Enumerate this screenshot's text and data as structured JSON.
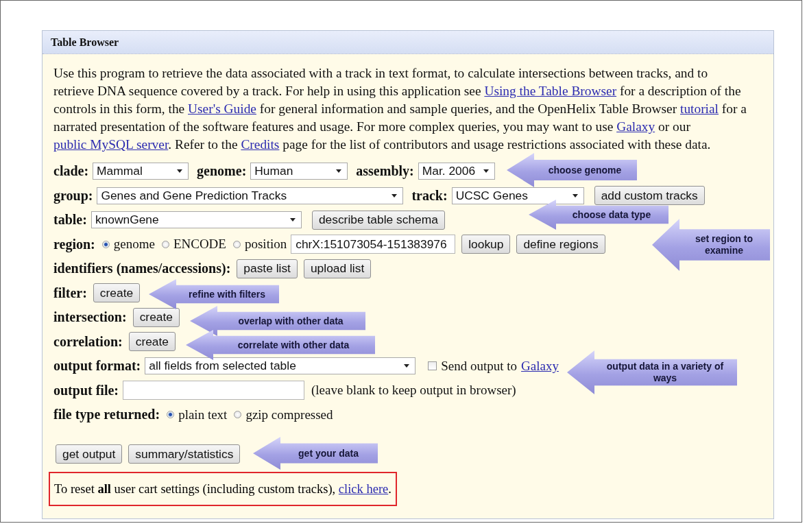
{
  "panel": {
    "title": "Table Browser"
  },
  "intro": [
    {
      "kind": "text",
      "text": "Use this program to retrieve the data associated with a track in text format, to calculate intersections between tracks, and to retrieve DNA sequence covered by a track. For help in using this application see "
    },
    {
      "kind": "link",
      "text": "Using the Table Browser"
    },
    {
      "kind": "text",
      "text": " for a description of the controls in this form, the "
    },
    {
      "kind": "link",
      "text": "User's Guide"
    },
    {
      "kind": "text",
      "text": " for general information and sample queries, and the OpenHelix Table Browser "
    },
    {
      "kind": "link",
      "text": "tutorial"
    },
    {
      "kind": "text",
      "text": " for a narrated presentation of the software features and usage. For more complex queries, you may want to use "
    },
    {
      "kind": "link",
      "text": "Galaxy"
    },
    {
      "kind": "text",
      "text": " or our "
    },
    {
      "kind": "link",
      "text": "public MySQL server"
    },
    {
      "kind": "text",
      "text": ". Refer to the "
    },
    {
      "kind": "link",
      "text": "Credits"
    },
    {
      "kind": "text",
      "text": " page for the list of contributors and usage restrictions associated with these data."
    }
  ],
  "rows": [
    {
      "items": [
        {
          "kind": "label",
          "text": "clade:"
        },
        {
          "kind": "select",
          "value": "Mammal"
        },
        {
          "kind": "label",
          "text": "genome:"
        },
        {
          "kind": "select",
          "value": "Human"
        },
        {
          "kind": "label",
          "text": "assembly:"
        },
        {
          "kind": "select",
          "value": "Mar. 2006"
        }
      ]
    },
    {
      "items": [
        {
          "kind": "label",
          "text": "group:"
        },
        {
          "kind": "select",
          "value": "Genes and Gene Prediction Tracks"
        },
        {
          "kind": "label",
          "text": "track:"
        },
        {
          "kind": "select",
          "value": "UCSC Genes"
        },
        {
          "kind": "button",
          "text": "add custom tracks"
        }
      ]
    },
    {
      "items": [
        {
          "kind": "label",
          "text": "table:"
        },
        {
          "kind": "select",
          "value": "knownGene"
        },
        {
          "kind": "button",
          "text": "describe table schema"
        }
      ]
    },
    {
      "items": [
        {
          "kind": "label",
          "text": "region:"
        },
        {
          "kind": "radio",
          "text": "genome",
          "selected": true
        },
        {
          "kind": "radio",
          "text": "ENCODE",
          "selected": false
        },
        {
          "kind": "radio",
          "text": "position",
          "selected": false
        },
        {
          "kind": "input",
          "value": "chrX:151073054-151383976"
        },
        {
          "kind": "button",
          "text": "lookup"
        },
        {
          "kind": "button",
          "text": "define regions"
        }
      ]
    },
    {
      "items": [
        {
          "kind": "label",
          "text": "identifiers (names/accessions):"
        },
        {
          "kind": "button",
          "text": "paste list"
        },
        {
          "kind": "button",
          "text": "upload list"
        }
      ]
    },
    {
      "items": [
        {
          "kind": "label",
          "text": "filter:"
        },
        {
          "kind": "button",
          "text": "create"
        }
      ]
    },
    {
      "items": [
        {
          "kind": "label",
          "text": "intersection:"
        },
        {
          "kind": "button",
          "text": "create"
        }
      ]
    },
    {
      "items": [
        {
          "kind": "label",
          "text": "correlation:"
        },
        {
          "kind": "button",
          "text": "create"
        }
      ]
    },
    {
      "items": [
        {
          "kind": "label",
          "text": "output format:"
        },
        {
          "kind": "select",
          "value": "all fields from selected table"
        },
        {
          "kind": "checkbox",
          "text": "Send output to",
          "checked": false
        },
        {
          "kind": "link",
          "text": "Galaxy"
        }
      ]
    },
    {
      "items": [
        {
          "kind": "label",
          "text": "output file:"
        },
        {
          "kind": "input",
          "value": ""
        },
        {
          "kind": "note",
          "text": "(leave blank to keep output in browser)"
        }
      ]
    },
    {
      "items": [
        {
          "kind": "label",
          "text": "file type returned:"
        },
        {
          "kind": "radio",
          "text": "plain text",
          "selected": true
        },
        {
          "kind": "radio",
          "text": "gzip compressed",
          "selected": false
        }
      ]
    },
    {
      "items": [
        {
          "kind": "button",
          "text": "get output"
        },
        {
          "kind": "button",
          "text": "summary/statistics"
        }
      ]
    }
  ],
  "reset": {
    "text": "To reset **all** user cart settings (including custom tracks), ",
    "link": "click here",
    "end": "."
  },
  "callouts": [
    {
      "text": "choose genome"
    },
    {
      "text": "choose data type"
    },
    {
      "text": "set region to examine"
    },
    {
      "text": "refine with filters"
    },
    {
      "text": "overlap with other data"
    },
    {
      "text": "correlate with other data"
    },
    {
      "text": "output data in a variety of ways"
    },
    {
      "text": "get your data"
    }
  ]
}
